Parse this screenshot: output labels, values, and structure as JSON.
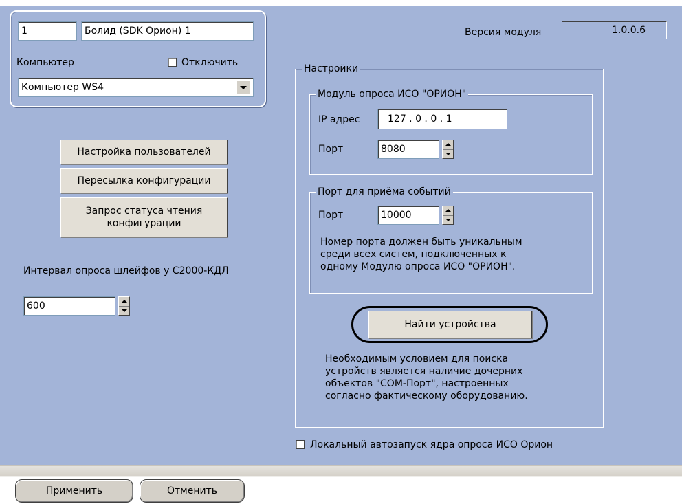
{
  "object": {
    "id": "1",
    "name": "Болид (SDK Орион) 1",
    "computer_label": "Компьютер",
    "disable_label": "Отключить",
    "computer_value": "Компьютер WS4"
  },
  "module_version": {
    "label": "Версия модуля",
    "value": "1.0.0.6"
  },
  "buttons": {
    "users_setup": "Настройка пользователей",
    "send_config": "Пересылка конфигурации",
    "config_status_line1": "Запрос статуса чтения",
    "config_status_line2": "конфигурации",
    "find_devices": "Найти устройства",
    "apply": "Применить",
    "cancel": "Отменить"
  },
  "poll_interval": {
    "label": "Интервал опроса шлейфов у С2000-КДЛ",
    "value": "600"
  },
  "settings": {
    "title": "Настройки",
    "orion_module": {
      "title": "Модуль опроса ИСО \"ОРИОН\"",
      "ip_label": "IP адрес",
      "ip_value": "127 .  0  .  0  . 1",
      "port_label": "Порт",
      "port_value": "8080"
    },
    "events_port": {
      "title": "Порт для приёма событий",
      "port_label": "Порт",
      "port_value": "10000",
      "note": "Номер порта должен быть уникальным\nсреди всех систем, подключенных к\nодному Модулю опроса ИСО \"ОРИОН\"."
    },
    "find_note": "Необходимым условием для поиска\nустройств является наличие дочерних\nобъектов \"COM-Порт\", настроенных\nсогласно фактическому оборудованию."
  },
  "local_autostart_label": "Локальный автозапуск ядра опроса ИСО Орион"
}
